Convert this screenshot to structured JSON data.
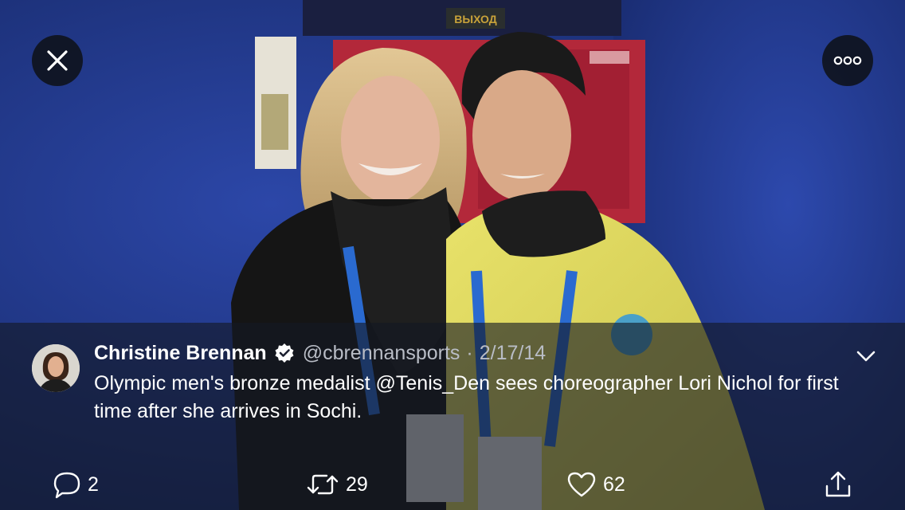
{
  "icons": {
    "close": "close-icon",
    "more": "more-icon",
    "verified": "verified-badge-icon",
    "chevron": "chevron-down-icon",
    "reply": "reply-icon",
    "retweet": "retweet-icon",
    "like": "heart-icon",
    "share": "share-icon"
  },
  "colors": {
    "overlay": "#141824",
    "text": "#ffffff",
    "secondary_text": "#b9bdc6",
    "verified": "#ffffff"
  },
  "tweet": {
    "author_name": "Christine Brennan",
    "handle": "@cbrennansports",
    "separator": "·",
    "date": "2/17/14",
    "text_before": "Olympic men's bronze medalist ",
    "mention": "@Tenis_Den",
    "text_after": " sees choreographer Lori Nichol for first time after she arrives in Sochi."
  },
  "actions": {
    "reply_count": "2",
    "retweet_count": "29",
    "like_count": "62"
  },
  "photo": {
    "exit_sign": "ВЫХОД"
  }
}
